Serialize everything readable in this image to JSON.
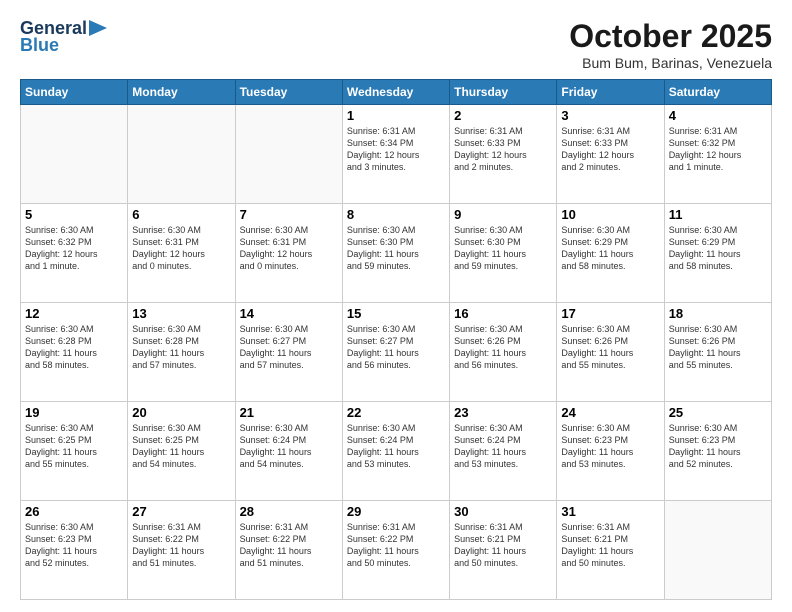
{
  "header": {
    "logo_line1": "General",
    "logo_line2": "Blue",
    "main_title": "October 2025",
    "subtitle": "Bum Bum, Barinas, Venezuela"
  },
  "weekdays": [
    "Sunday",
    "Monday",
    "Tuesday",
    "Wednesday",
    "Thursday",
    "Friday",
    "Saturday"
  ],
  "weeks": [
    [
      {
        "day": "",
        "info": ""
      },
      {
        "day": "",
        "info": ""
      },
      {
        "day": "",
        "info": ""
      },
      {
        "day": "1",
        "info": "Sunrise: 6:31 AM\nSunset: 6:34 PM\nDaylight: 12 hours\nand 3 minutes."
      },
      {
        "day": "2",
        "info": "Sunrise: 6:31 AM\nSunset: 6:33 PM\nDaylight: 12 hours\nand 2 minutes."
      },
      {
        "day": "3",
        "info": "Sunrise: 6:31 AM\nSunset: 6:33 PM\nDaylight: 12 hours\nand 2 minutes."
      },
      {
        "day": "4",
        "info": "Sunrise: 6:31 AM\nSunset: 6:32 PM\nDaylight: 12 hours\nand 1 minute."
      }
    ],
    [
      {
        "day": "5",
        "info": "Sunrise: 6:30 AM\nSunset: 6:32 PM\nDaylight: 12 hours\nand 1 minute."
      },
      {
        "day": "6",
        "info": "Sunrise: 6:30 AM\nSunset: 6:31 PM\nDaylight: 12 hours\nand 0 minutes."
      },
      {
        "day": "7",
        "info": "Sunrise: 6:30 AM\nSunset: 6:31 PM\nDaylight: 12 hours\nand 0 minutes."
      },
      {
        "day": "8",
        "info": "Sunrise: 6:30 AM\nSunset: 6:30 PM\nDaylight: 11 hours\nand 59 minutes."
      },
      {
        "day": "9",
        "info": "Sunrise: 6:30 AM\nSunset: 6:30 PM\nDaylight: 11 hours\nand 59 minutes."
      },
      {
        "day": "10",
        "info": "Sunrise: 6:30 AM\nSunset: 6:29 PM\nDaylight: 11 hours\nand 58 minutes."
      },
      {
        "day": "11",
        "info": "Sunrise: 6:30 AM\nSunset: 6:29 PM\nDaylight: 11 hours\nand 58 minutes."
      }
    ],
    [
      {
        "day": "12",
        "info": "Sunrise: 6:30 AM\nSunset: 6:28 PM\nDaylight: 11 hours\nand 58 minutes."
      },
      {
        "day": "13",
        "info": "Sunrise: 6:30 AM\nSunset: 6:28 PM\nDaylight: 11 hours\nand 57 minutes."
      },
      {
        "day": "14",
        "info": "Sunrise: 6:30 AM\nSunset: 6:27 PM\nDaylight: 11 hours\nand 57 minutes."
      },
      {
        "day": "15",
        "info": "Sunrise: 6:30 AM\nSunset: 6:27 PM\nDaylight: 11 hours\nand 56 minutes."
      },
      {
        "day": "16",
        "info": "Sunrise: 6:30 AM\nSunset: 6:26 PM\nDaylight: 11 hours\nand 56 minutes."
      },
      {
        "day": "17",
        "info": "Sunrise: 6:30 AM\nSunset: 6:26 PM\nDaylight: 11 hours\nand 55 minutes."
      },
      {
        "day": "18",
        "info": "Sunrise: 6:30 AM\nSunset: 6:26 PM\nDaylight: 11 hours\nand 55 minutes."
      }
    ],
    [
      {
        "day": "19",
        "info": "Sunrise: 6:30 AM\nSunset: 6:25 PM\nDaylight: 11 hours\nand 55 minutes."
      },
      {
        "day": "20",
        "info": "Sunrise: 6:30 AM\nSunset: 6:25 PM\nDaylight: 11 hours\nand 54 minutes."
      },
      {
        "day": "21",
        "info": "Sunrise: 6:30 AM\nSunset: 6:24 PM\nDaylight: 11 hours\nand 54 minutes."
      },
      {
        "day": "22",
        "info": "Sunrise: 6:30 AM\nSunset: 6:24 PM\nDaylight: 11 hours\nand 53 minutes."
      },
      {
        "day": "23",
        "info": "Sunrise: 6:30 AM\nSunset: 6:24 PM\nDaylight: 11 hours\nand 53 minutes."
      },
      {
        "day": "24",
        "info": "Sunrise: 6:30 AM\nSunset: 6:23 PM\nDaylight: 11 hours\nand 53 minutes."
      },
      {
        "day": "25",
        "info": "Sunrise: 6:30 AM\nSunset: 6:23 PM\nDaylight: 11 hours\nand 52 minutes."
      }
    ],
    [
      {
        "day": "26",
        "info": "Sunrise: 6:30 AM\nSunset: 6:23 PM\nDaylight: 11 hours\nand 52 minutes."
      },
      {
        "day": "27",
        "info": "Sunrise: 6:31 AM\nSunset: 6:22 PM\nDaylight: 11 hours\nand 51 minutes."
      },
      {
        "day": "28",
        "info": "Sunrise: 6:31 AM\nSunset: 6:22 PM\nDaylight: 11 hours\nand 51 minutes."
      },
      {
        "day": "29",
        "info": "Sunrise: 6:31 AM\nSunset: 6:22 PM\nDaylight: 11 hours\nand 50 minutes."
      },
      {
        "day": "30",
        "info": "Sunrise: 6:31 AM\nSunset: 6:21 PM\nDaylight: 11 hours\nand 50 minutes."
      },
      {
        "day": "31",
        "info": "Sunrise: 6:31 AM\nSunset: 6:21 PM\nDaylight: 11 hours\nand 50 minutes."
      },
      {
        "day": "",
        "info": ""
      }
    ]
  ]
}
